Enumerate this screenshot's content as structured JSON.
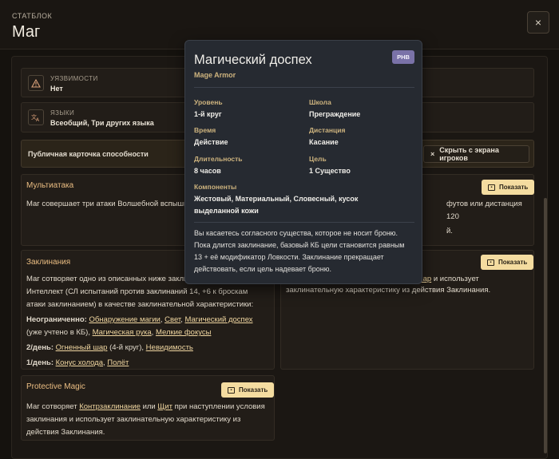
{
  "header": {
    "overline": "СТАТБЛОК",
    "title": "Маг",
    "close_icon": "×"
  },
  "traits": [
    {
      "label": "УЯЗВИМОСТИ",
      "value": "Нет",
      "icon": "warning-icon"
    },
    {
      "label": "ЯЗЫКИ",
      "value": "Всеобщий, Три других языка",
      "icon": "translate-icon"
    }
  ],
  "public_card": {
    "label": "Публичная карточка способности",
    "hide_label": "Скрыть с экрана игроков",
    "hide_icon": "×"
  },
  "abilities": {
    "show_label": "Показать",
    "multiattack": {
      "title": "Мультиатака",
      "text_left": "Маг совершает три атаки Волшебной вспышк",
      "text_right_1": "футов или дистанция 120",
      "text_right_2": "й."
    },
    "spellcasting": {
      "title": "Заклинания",
      "line1": "Маг сотворяет одно из описанных ниже заклин",
      "line2": "Интеллект (СЛ испытаний против заклинаний 14, +6 к броскам",
      "line3": "атаки заклинанием) в качестве заклинательной характеристики:",
      "at_will_label": "Неограниченно:",
      "at_will_1": "Обнаружение магии",
      "at_will_2": "Свет",
      "at_will_3": "Магический доспех",
      "at_will_note": "(уже учтено в КБ),",
      "at_will_4": "Магическая рука",
      "at_will_5": "Мелкие фокусы",
      "per_day2_label": "2/день:",
      "per_day2_1": "Огненный шар",
      "per_day2_note": "(4-й круг),",
      "per_day2_2": "Невидимость",
      "per_day1_label": "1/день:",
      "per_day1_1": "Конус холода",
      "per_day1_2": "Полёт"
    },
    "right_card": {
      "link_fragment": "шар",
      "text_1": "и использует",
      "text_2": "заклинательную характеристику из действия Заклинания."
    },
    "protective": {
      "title": "Protective Magic",
      "t1": "Маг сотворяет",
      "link1": "Контрзаклинание",
      "t2": "или",
      "link2": "Щит",
      "t3": "при наступлении условия",
      "line2": "заклинания и использует заклинательную характеристику из",
      "line3": "действия Заклинания."
    }
  },
  "spell_modal": {
    "title": "Магический доспех",
    "subtitle": "Mage Armor",
    "badge": "PHB",
    "level_label": "Уровень",
    "level": "1-й круг",
    "school_label": "Школа",
    "school": "Преграждение",
    "time_label": "Время",
    "time": "Действие",
    "range_label": "Дистанция",
    "range": "Касание",
    "duration_label": "Длительность",
    "duration": "8 часов",
    "target_label": "Цель",
    "target": "1 Существо",
    "components_label": "Компоненты",
    "components_1": "Жестовый, Материальный, Словесный, кусок",
    "components_2": "выделанной кожи",
    "desc_1": "Вы касаетесь согласного существа, которое не носит броню.",
    "desc_2": "Пока длится заклинание, базовый КБ цели становится равным",
    "desc_3": "13 + её модификатор Ловкости. Заклинание прекращает",
    "desc_4": "действовать, если цель надевает броню."
  }
}
